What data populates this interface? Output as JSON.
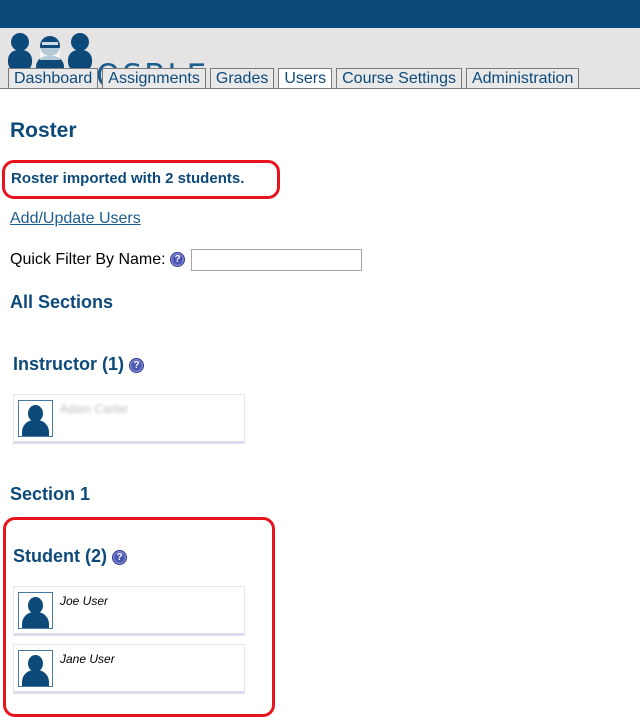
{
  "app": {
    "logo_text": "OSBLE"
  },
  "tabs": [
    {
      "label": "Dashboard"
    },
    {
      "label": "Assignments"
    },
    {
      "label": "Grades"
    },
    {
      "label": "Users",
      "active": true
    },
    {
      "label": "Course Settings"
    },
    {
      "label": "Administration"
    }
  ],
  "page": {
    "title": "Roster",
    "notice": "Roster imported with 2 students.",
    "add_update_link": "Add/Update Users",
    "filter_label": "Quick Filter By Name:",
    "filter_value": "",
    "help_glyph": "?"
  },
  "sections": {
    "all_heading": "All Sections",
    "instructor_heading": "Instructor (1)",
    "instructor_name": "Adam Carter",
    "section_heading": "Section 1",
    "student_heading": "Student (2)",
    "students": [
      {
        "name": "Joe User"
      },
      {
        "name": "Jane User"
      }
    ]
  },
  "colors": {
    "brand_blue": "#0d4a7a",
    "highlight_red": "#e8141d"
  }
}
